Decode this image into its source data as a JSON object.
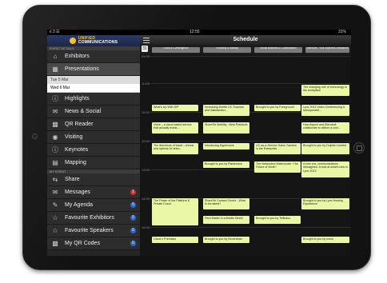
{
  "status": {
    "carrier": "ıl 3 ☰",
    "time": "12:55",
    "battery": "31%"
  },
  "sidebar": {
    "brand_top": "UNIFIED",
    "brand_bottom": "COMMUNICATIONS",
    "event_details_label": "EVENT DETAILS",
    "exhibitors": "Exhibitors",
    "presentations": "Presentations",
    "days": [
      "Tue 5 Mar",
      "Wed 6 Mar"
    ],
    "items": [
      "Highlights",
      "News & Social",
      "QR Reader",
      "Visiting",
      "Keynotes",
      "Mapping"
    ],
    "my_event_label": "MY EVENT",
    "my_items": [
      {
        "label": "Share",
        "badge": ""
      },
      {
        "label": "Messages",
        "badge": "1",
        "badge_color": "#d62d2d"
      },
      {
        "label": "My Agenda",
        "badge": "0",
        "badge_color": "#2b66c8"
      },
      {
        "label": "Favourite Exhibitors",
        "badge": "0",
        "badge_color": "#2b66c8"
      },
      {
        "label": "Favourite Speakers",
        "badge": "0",
        "badge_color": "#2b66c8"
      },
      {
        "label": "My QR Codes",
        "badge": "0",
        "badge_color": "#2b66c8"
      }
    ]
  },
  "main": {
    "title": "Schedule",
    "calendar_label": "31",
    "tracks": [
      "Cloud & Convergence",
      "Flexibility & Mobility",
      "Social Business & Collaboration",
      "Microsoft - Your Business Unleashed"
    ],
    "times": [
      "09:00",
      "10:00",
      "11:00",
      "12:00",
      "13:00",
      "14:00",
      "15:00"
    ],
    "events": [
      {
        "text": "The changing role of technology in the workplace"
      },
      {
        "text": "What's Up With SIP"
      },
      {
        "text": "Increasing Mobile UC Success and Satisfaction..."
      },
      {
        "text": "Brought to you by Foreground"
      },
      {
        "text": "Lync 2013 Video Conferencing & Interoperabil..."
      },
      {
        "text": "Voice – a cloud-based service that actually exists ..."
      },
      {
        "text": "ShoreTel Mobility - Best Practices"
      },
      {
        "text": "How Aspect and Microsoft collaborate to deliver a com..."
      },
      {
        "text": "The directions of travel – trends and options for telec..."
      },
      {
        "text": "Introducing Hypervoice"
      },
      {
        "text": "UC-as-a-Service Gains Traction in the Enterprise..."
      },
      {
        "text": "Brought to you by Dolphin Limited"
      },
      {
        "text": "Brought to you by Plantronics"
      },
      {
        "text": "The Networked Watercooler: The Future of Work?"
      },
      {
        "text": "A new era, communications reimagined. A look at what's new in Lync 2013"
      },
      {
        "text": "The Power of the Platform & Private Cloud"
      },
      {
        "text": "ShoreTel Contact Centre - What is the latest?"
      },
      {
        "text": "Brought to you by Lync Hosting Experience"
      },
      {
        "text": "Flexi Matter in a Mobile World"
      },
      {
        "text": "Brought to you by Tellindus"
      },
      {
        "text": "Cloud v Premises"
      },
      {
        "text": "Brought to you by Sennheiser"
      },
      {
        "text": "Brought to you by snom"
      }
    ]
  }
}
